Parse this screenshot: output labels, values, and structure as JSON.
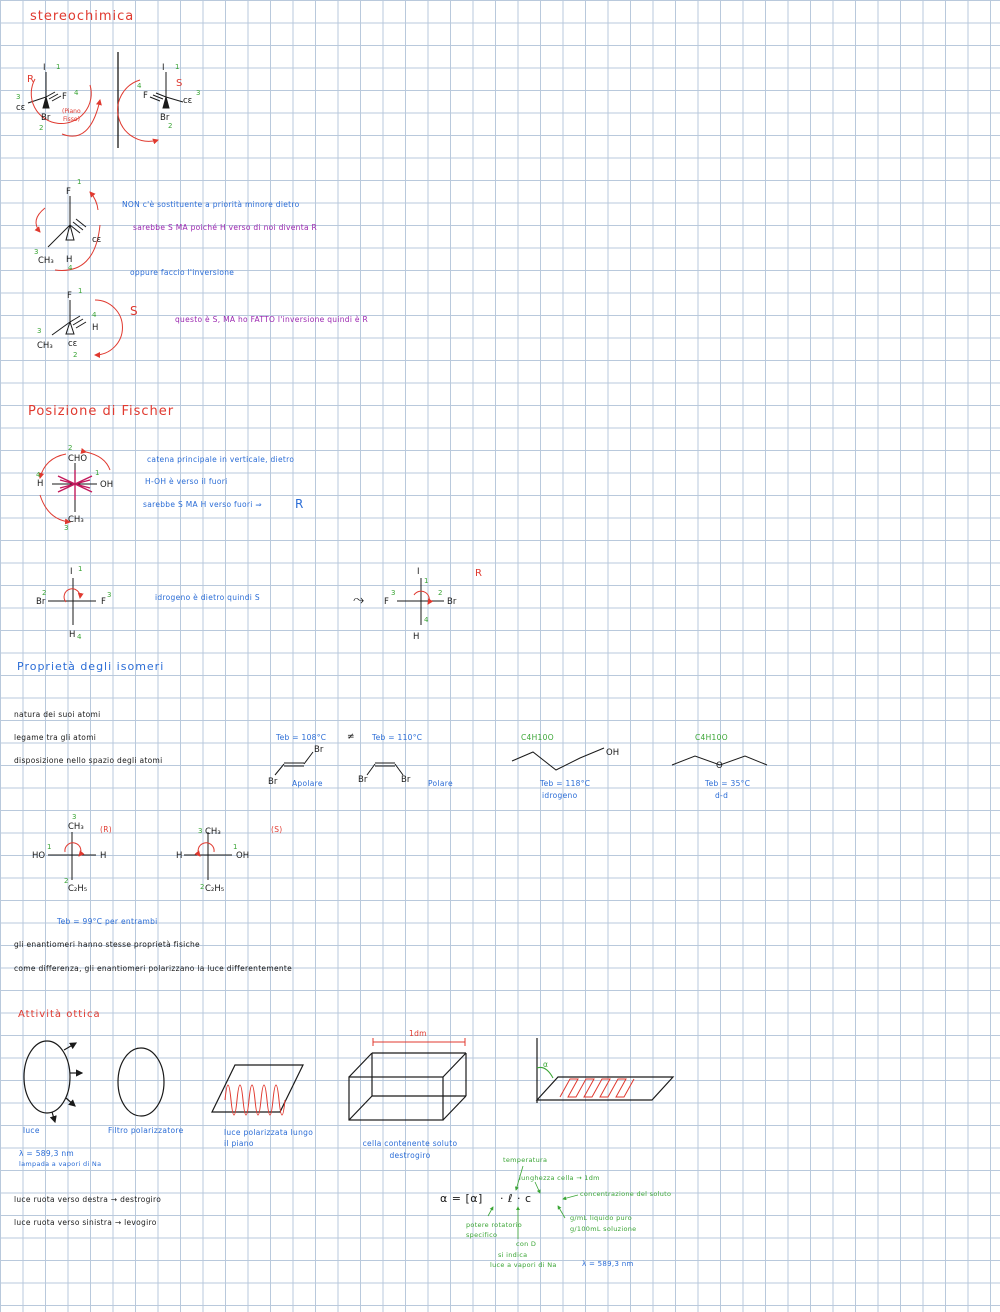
{
  "headings": {
    "stereo": "stereochimica",
    "fischer": "Posizione di Fischer",
    "isomeri": "Proprietà degli isomeri",
    "ottica": "Attività ottica"
  },
  "stereo_notes": {
    "line1": "NON c'è sostituente a priorità minore dietro",
    "line2": "sarebbe S MA poiché H verso di noi diventa R",
    "line3": "oppure faccio l'inversione",
    "line4": "questo è S, MA ho FATTO l'inversione quindi è R",
    "s_label": "S",
    "r_label": "R"
  },
  "fischer_notes": {
    "line1": "catena principale in verticale, dietro",
    "line2": "H-OH è verso il fuori",
    "line3": "sarebbe S MA H verso fuori ⇒",
    "line3_r": "R",
    "idrogeno": "idrogeno è dietro quindi S",
    "r_label": "R"
  },
  "isomeri": {
    "bullets": [
      "natura dei suoi atomi",
      "legame tra gli atomi",
      "disposizione nello spazio degli atomi"
    ],
    "teb1": "Teb = 108°C",
    "neq": "≠",
    "teb2": "Teb = 110°C",
    "apolare": "Apolare",
    "polare": "Polare",
    "form1": "C4H10O",
    "form2": "C4H10O",
    "teb3": "Teb = 118°C",
    "idrogeno": "idrogeno",
    "teb4": "Teb = 35°C",
    "dd": "d-d",
    "r_tag": "(R)",
    "s_tag": "(S)",
    "teb5": "Teb = 99°C per entrambi",
    "bullet4": "gli enantiomeri hanno stesse proprietà fisiche",
    "bullet5": "come differenza, gli enantiomeri polarizzano la luce differentemente"
  },
  "ottica": {
    "luce": "luce",
    "filtro": "Filtro polarizzatore",
    "luce_pol": "luce polarizzata lungo il piano",
    "cella": "cella contenente soluto destrogiro",
    "dm": "1dm",
    "lambda": "λ = 589,3 nm",
    "lampada": "lampada a vapori di Na",
    "b1": "luce ruota verso destra → destrogiro",
    "b2": "luce ruota verso sinistra → levogiro",
    "formula": "α = [α]",
    "formula2": "· ℓ · c",
    "temperatura": "temperatura",
    "lunghezza": "lunghezza cella → 1dm",
    "concentrazione": "concentrazione del soluto",
    "gml": "g/mL liquido puro",
    "g100": "g/100mL soluzione",
    "potere": "potere rotatorio specifico",
    "con_d": "con D",
    "si_indica": "si indica",
    "luce_na": "luce a vapori di Na",
    "lambda2": "λ = 589,3 nm",
    "alpha": "α"
  },
  "colors": {
    "red": "#e0392f",
    "blue": "#2a6cd6",
    "purple": "#9b27b0",
    "green": "#3aa535",
    "magenta": "#c2185b",
    "grid": "#b9c9dc"
  }
}
